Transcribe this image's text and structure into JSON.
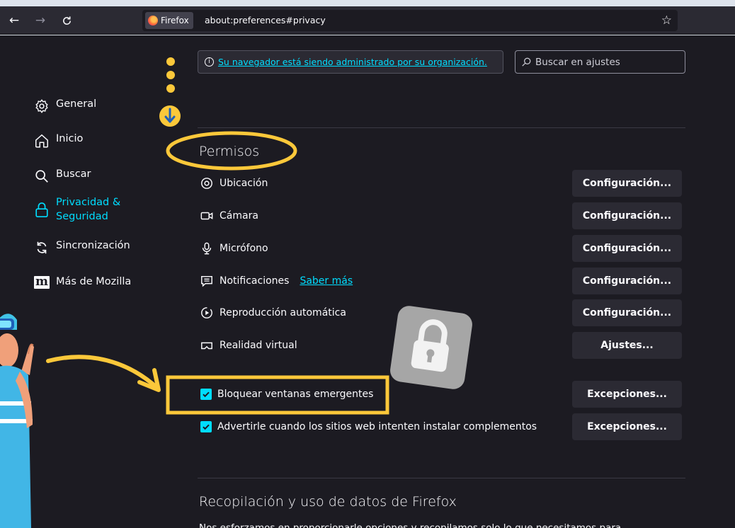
{
  "browser": {
    "brand": "Firefox",
    "url": "about:preferences#privacy",
    "icons": [
      "back-arrow-icon",
      "forward-arrow-icon",
      "reload-icon",
      "bookmark-star-icon"
    ]
  },
  "policy": {
    "text": "Su navegador está siendo administrado por su organización."
  },
  "search": {
    "placeholder": "Buscar en ajustes"
  },
  "sidebar": {
    "items": [
      {
        "label": "General",
        "icon": "gear-icon"
      },
      {
        "label": "Inicio",
        "icon": "home-icon"
      },
      {
        "label": "Buscar",
        "icon": "search-icon"
      },
      {
        "label_line1": "Privacidad &",
        "label_line2": "Seguridad",
        "icon": "lock-icon",
        "active": true
      },
      {
        "label": "Sincronización",
        "icon": "sync-icon"
      },
      {
        "label": "Más de Mozilla",
        "logo_text": "m",
        "icon": "mozilla-logo-icon"
      }
    ]
  },
  "permissions": {
    "title": "Permisos",
    "rows": [
      {
        "label": "Ubicación",
        "icon": "location-icon",
        "button": "Configuración..."
      },
      {
        "label": "Cámara",
        "icon": "camera-icon",
        "button": "Configuración..."
      },
      {
        "label": "Micrófono",
        "icon": "microphone-icon",
        "button": "Configuración..."
      },
      {
        "label": "Notificaciones",
        "icon": "notification-icon",
        "link": "Saber más",
        "button": "Configuración..."
      },
      {
        "label": "Reproducción automática",
        "icon": "autoplay-icon",
        "button": "Configuración..."
      },
      {
        "label": "Realidad virtual",
        "icon": "vr-icon",
        "button": "Ajustes..."
      }
    ],
    "checkboxes": [
      {
        "label": "Bloquear ventanas emergentes",
        "checked": true,
        "button": "Excepciones..."
      },
      {
        "label": "Advertirle cuando los sitios web intenten instalar complementos",
        "checked": true,
        "button": "Excepciones..."
      }
    ]
  },
  "data_collection": {
    "title": "Recopilación y uso de datos de Firefox",
    "text": "Nos esforzamos en proporcionarle opciones y recopilamos solo lo que necesitamos para"
  },
  "colors": {
    "background": "#1c1b22",
    "accent": "#00ddff",
    "highlight": "#fbc83a",
    "pointer_blue": "#1f5fb8"
  }
}
